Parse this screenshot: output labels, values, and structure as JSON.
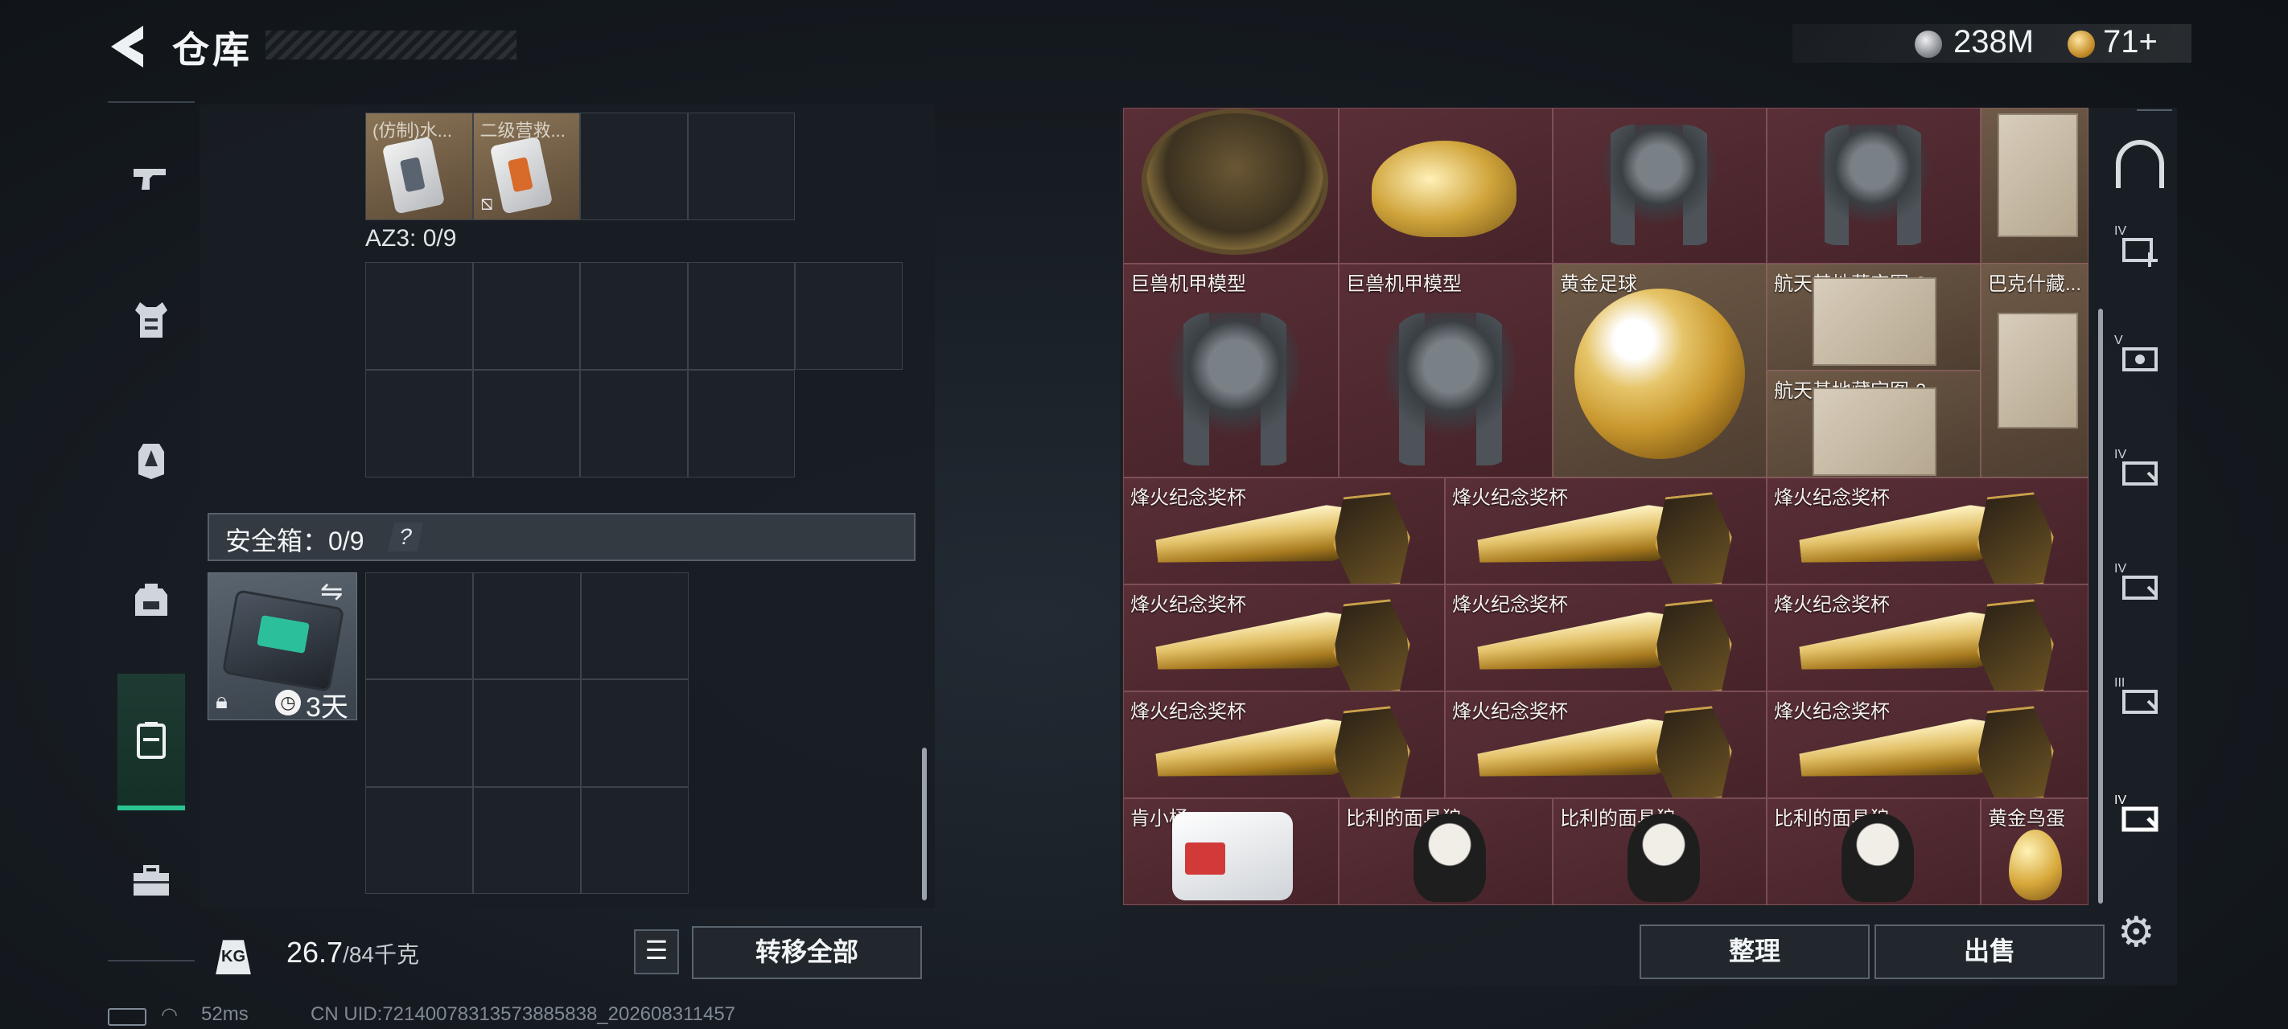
{
  "header": {
    "title": "仓库",
    "currency_silver": "238M",
    "currency_gold": "71+"
  },
  "left": {
    "top_items": [
      {
        "name": "(仿制)水..."
      },
      {
        "name": "二级营救..."
      }
    ],
    "az3_label": "AZ3: 0/9",
    "safe_label": "安全箱：0/9",
    "safe_help": "?",
    "safe_item_days": "3天",
    "weight_value": "26.7",
    "weight_max": "/84千克",
    "kg_label": "KG",
    "transfer_all": "转移全部"
  },
  "status": {
    "ping": "52ms",
    "uid": "CN UID:7214007831357388583​8_202608311457"
  },
  "inventory": {
    "row1": [
      {
        "name": ""
      },
      {
        "name": ""
      },
      {
        "name": ""
      },
      {
        "name": ""
      },
      {
        "name": ""
      }
    ],
    "row2": [
      {
        "name": "巨兽机甲模型"
      },
      {
        "name": "巨兽机甲模型"
      },
      {
        "name": "黄金足球"
      },
      {
        "name": "航天基地藏宝图-3"
      },
      {
        "name": "巴克什藏..."
      }
    ],
    "row2_extra": {
      "name": "航天基地藏宝图-3"
    },
    "trophy_name": "烽火纪念奖杯",
    "row6": [
      {
        "name": "肯小桶"
      },
      {
        "name": "比利的面具狼"
      },
      {
        "name": "比利的面具狼"
      },
      {
        "name": "比利的面具狼"
      },
      {
        "name": "黄金鸟蛋"
      }
    ]
  },
  "actions": {
    "sort": "整理",
    "sell": "出售"
  },
  "right_rail": {
    "labels": [
      "IV",
      "V",
      "IV",
      "IV",
      "III",
      "IV"
    ]
  },
  "icons": [
    "back-icon",
    "pistol-icon",
    "vest-icon",
    "armor-icon",
    "backpack-icon",
    "safebox-icon",
    "toolbox-icon",
    "weight-icon",
    "list-icon",
    "home-icon",
    "gear-icon"
  ]
}
